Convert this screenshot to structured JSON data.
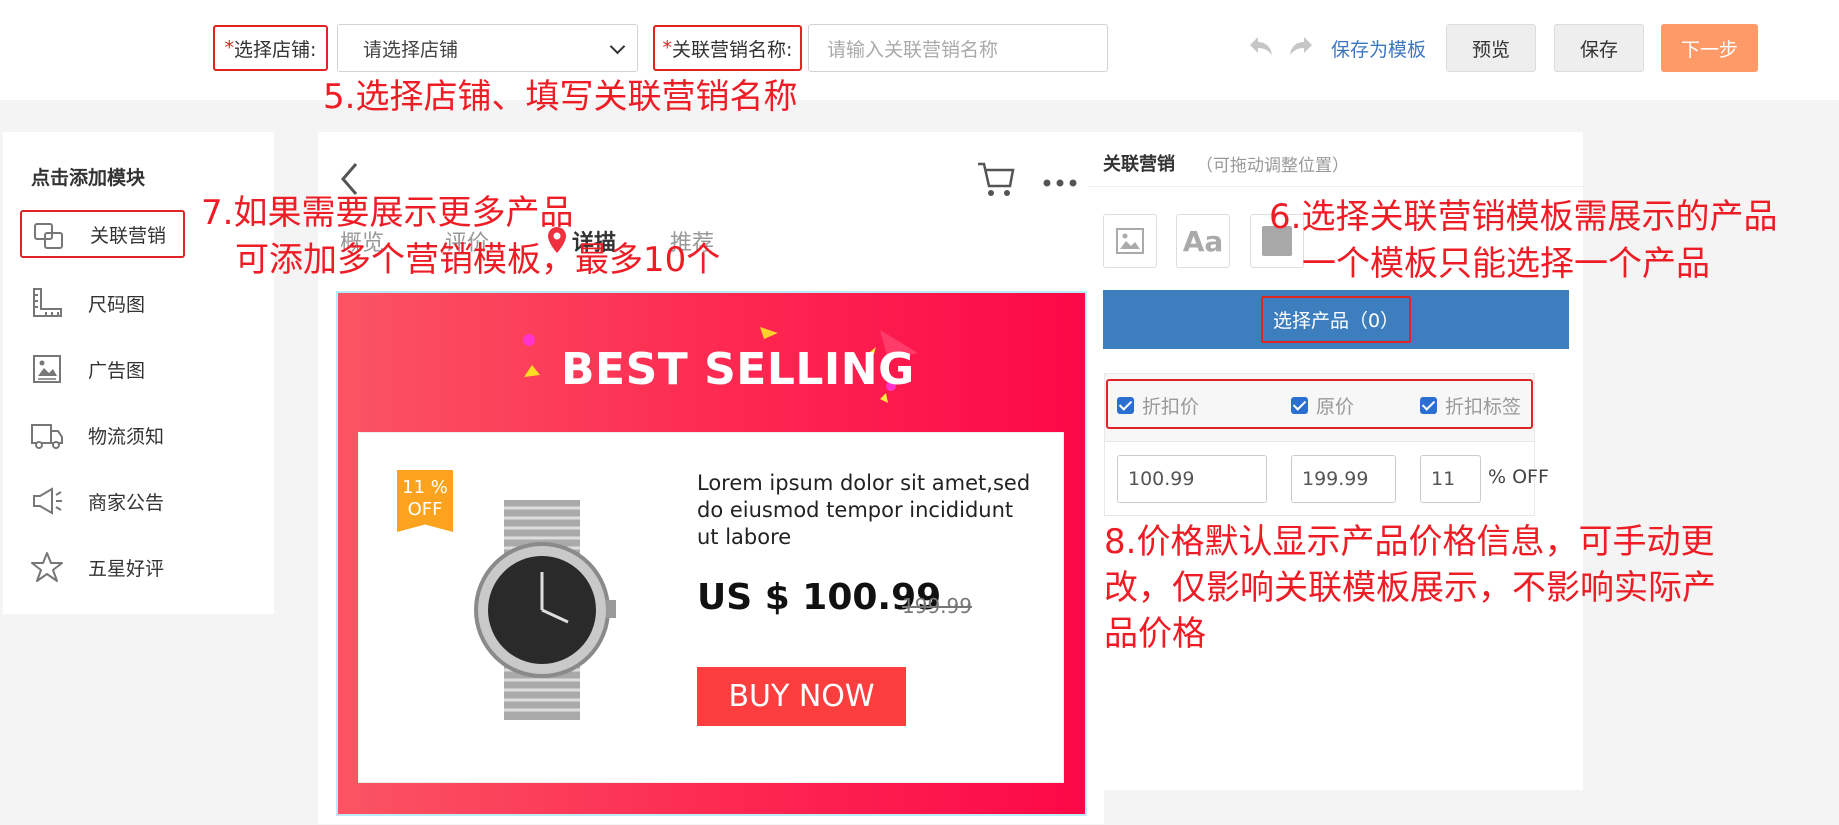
{
  "topbar": {
    "store_label_req": "*",
    "store_label": "选择店铺:",
    "store_placeholder": "请选择店铺",
    "name_label_req": "*",
    "name_label": "关联营销名称:",
    "name_placeholder": "请输入关联营销名称",
    "save_template": "保存为模板",
    "preview": "预览",
    "save": "保存",
    "next": "下一步"
  },
  "annotations": {
    "a5": "5.选择店铺、填写关联营销名称",
    "a7_line1": "7.如果需要展示更多产品",
    "a7_line2": "可添加多个营销模板，最多10个",
    "a6_line1": "6.选择关联营销模板需展示的产品",
    "a6_line2": "一个模板只能选择一个产品",
    "a8_line1": "8.价格默认显示产品价格信息，可手动更",
    "a8_line2": "改，仅影响关联模板展示，不影响实际产",
    "a8_line3": "品价格"
  },
  "left_panel": {
    "title": "点击添加模块",
    "items": [
      {
        "label": "关联营销",
        "icon": "linked-squares-icon"
      },
      {
        "label": "尺码图",
        "icon": "ruler-icon"
      },
      {
        "label": "广告图",
        "icon": "image-icon"
      },
      {
        "label": "物流须知",
        "icon": "truck-icon"
      },
      {
        "label": "商家公告",
        "icon": "megaphone-icon"
      },
      {
        "label": "五星好评",
        "icon": "star-icon"
      }
    ]
  },
  "phone": {
    "tabs": [
      "概览",
      "评价",
      "详描",
      "推荐"
    ],
    "banner_title": "BEST SELLING",
    "discount_line1": "11 %",
    "discount_line2": "OFF",
    "product_desc": "Lorem ipsum dolor sit amet,sed do eiusmod tempor incididunt ut labore",
    "price": "US $ 100.99",
    "old_price": "199.99",
    "buy_now": "BUY NOW"
  },
  "right_panel": {
    "title": "关联营销",
    "subtitle": "（可拖动调整位置）",
    "select_product": "选择产品（0）",
    "options": [
      "折扣价",
      "原价",
      "折扣标签"
    ],
    "discount_price": "100.99",
    "original_price": "199.99",
    "discount_percent": "11",
    "off_suffix": "% OFF"
  },
  "colors": {
    "accent_red": "#ee1c25",
    "primary_blue": "#3d7ebf",
    "next_button": "#fd9a67"
  }
}
